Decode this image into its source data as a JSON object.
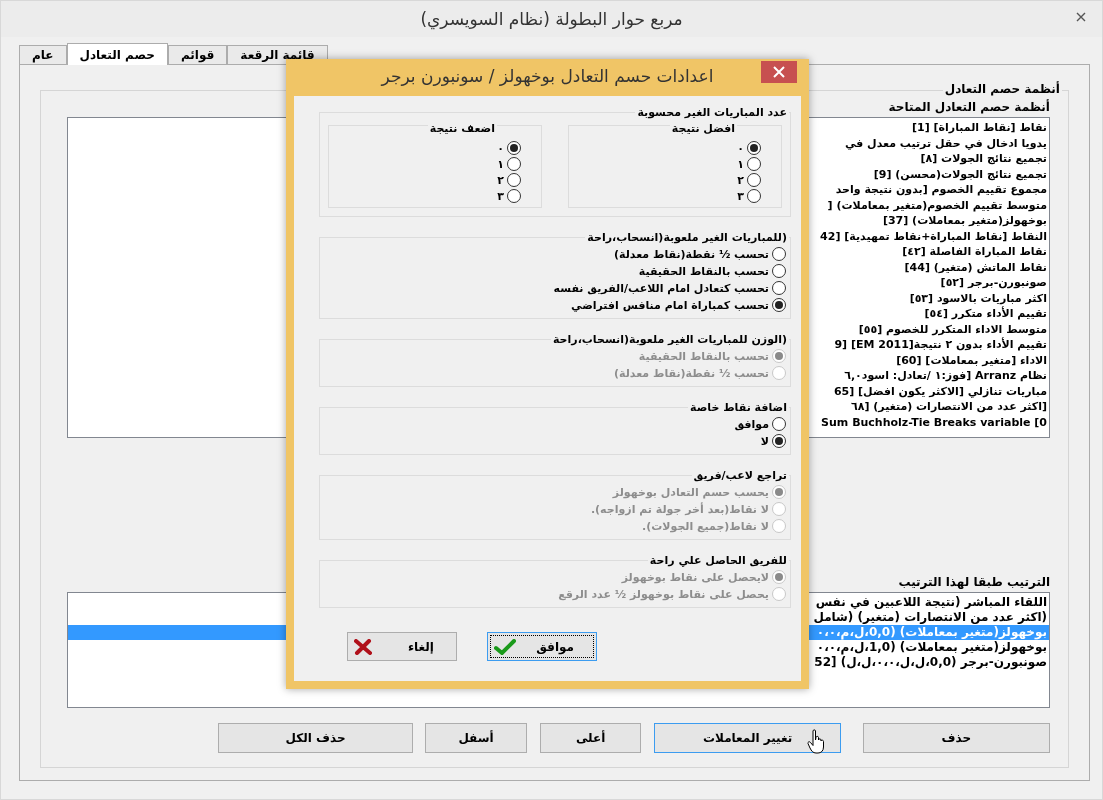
{
  "window": {
    "title": "مربع حوار البطولة (نظام السويسري)"
  },
  "tabs": [
    {
      "label": "قائمة الرقعة",
      "selected": false
    },
    {
      "label": "قوائم",
      "selected": false
    },
    {
      "label": "حصم التعادل",
      "selected": true
    },
    {
      "label": "عام",
      "selected": false
    }
  ],
  "tiebreak_group": {
    "title": "أنظمة حصم التعادل",
    "available_label": "أنظمة حصم التعادل المتاحة",
    "available": [
      "نقاط [نقاط المباراة] [1]",
      "يدويا ادخال في حقل ترتيب معدل في",
      "تجميع نتائج الجولات [٨]",
      "تجميع نتائج الجولات(محسن) [9]",
      "مجموع تقييم الخصوم [بدون نتيجة واحد",
      "متوسط تقييم الخصوم(متغير بمعاملات) [",
      "بوخهولز(متغير بمعاملات) [37]",
      "النقاط [نقاط المباراة+نقاط تمهيدية] [42",
      "نقاط المباراة الفاصلة [٤٢]",
      "نقاط الماتش (متغير) [44]",
      "صونبورن-برجر [٥٢]",
      "اكثر مباريات بالاسود [٥٣]",
      "تقييم الأداء متكرر [٥٤]",
      "متوسط الاداء المتكرر للخصوم [٥٥]",
      "تقييم الأداء بدون ٢ نتيجة[EM 2011] [9",
      "الاداء [متغير بمعاملات] [60]",
      "نظام Arranz [فوز:١ /تعادل: اسود٦,٠",
      "مباريات تنازلي [الاكثر يكون افضل] [65",
      "[اكثر عدد من الانتصارات (متغير) [٦٨",
      "Sum Buchholz-Tie Breaks variable [0"
    ],
    "order_label": "الترتيب طبقا لهذا الترتيب",
    "order": [
      {
        "text": "اللقاء المباشر (نتيجة اللاعبين في نفس",
        "selected": false
      },
      {
        "text": "(اكثر عدد من الانتصارات (متغير) (شامل",
        "selected": false
      },
      {
        "text": "بوخهولز(متغير بمعاملات) (0,0،ل،م،٠،٠",
        "selected": true
      },
      {
        "text": "بوخهولز(متغير بمعاملات) (1,0،ل،م،٠،٠",
        "selected": false
      },
      {
        "text": "صونبورن-برجر (0,0،ل،ل،٠،٠،ل،ل)  [52",
        "selected": false
      }
    ]
  },
  "buttons": [
    {
      "label": "حذف",
      "hovered": false
    },
    {
      "label": "تغيير المعاملات",
      "hovered": true
    },
    {
      "label": "أعلى",
      "hovered": false
    },
    {
      "label": "أسفل",
      "hovered": false
    },
    {
      "label": "حذف الكل",
      "hovered": false
    }
  ],
  "dialog": {
    "title": "اعدادات حسم التعادل بوخهولز / سونبورن برجر",
    "groups": [
      {
        "kind": "columns",
        "title": "عدد المباريات الغير محسوبة",
        "disabled": false,
        "columns": [
          {
            "title": "افضل نتيجة",
            "options": [
              {
                "label": "٠",
                "selected": true
              },
              {
                "label": "١",
                "selected": false
              },
              {
                "label": "٢",
                "selected": false
              },
              {
                "label": "٣",
                "selected": false
              }
            ]
          },
          {
            "title": "اضعف نتيجة",
            "options": [
              {
                "label": "٠",
                "selected": true
              },
              {
                "label": "١",
                "selected": false
              },
              {
                "label": "٢",
                "selected": false
              },
              {
                "label": "٣",
                "selected": false
              }
            ]
          }
        ]
      },
      {
        "kind": "list",
        "title": "(للمباريات الغير ملعوبة(انسحاب،راحة",
        "disabled": false,
        "options": [
          {
            "label": "تحسب ½ نقطة(نقاط معدلة)",
            "selected": false
          },
          {
            "label": "تحسب بالنقاط الحقيقية",
            "selected": false
          },
          {
            "label": "تحسب كتعادل امام اللاعب/الفريق نفسه",
            "selected": false
          },
          {
            "label": "تحسب كمباراة امام منافس افتراضي",
            "selected": true
          }
        ]
      },
      {
        "kind": "list",
        "title": "(الوزن للمباريات الغير ملعوبة(انسحاب،راحة",
        "disabled": true,
        "options": [
          {
            "label": "تحسب بالنقاط الحقيقية",
            "selected": true
          },
          {
            "label": "تحسب ½ نقطة(نقاط معدلة)",
            "selected": false
          }
        ]
      },
      {
        "kind": "list",
        "title": "اضافة نقاط خاصة",
        "disabled": false,
        "options": [
          {
            "label": "موافق",
            "selected": false
          },
          {
            "label": "لا",
            "selected": true
          }
        ]
      },
      {
        "kind": "list",
        "title": "تراجع لاعب/فريق",
        "disabled": true,
        "options": [
          {
            "label": "يحسب حسم التعادل بوخهولز",
            "selected": true
          },
          {
            "label": "لا نقاط(بعد أخر جولة تم ازواجه).",
            "selected": false
          },
          {
            "label": "لا نقاط(جميع الجولات).",
            "selected": false
          }
        ]
      },
      {
        "kind": "list",
        "title": "للفريق الحاصل علي راحة",
        "disabled": true,
        "options": [
          {
            "label": "لايحصل على نقاط بوخهولز",
            "selected": true
          },
          {
            "label": "يحصل على نقاط بوخهولز ½ عدد الرقع",
            "selected": false
          }
        ]
      }
    ],
    "buttons": [
      {
        "kind": "ok",
        "label": "موافق",
        "focused": true
      },
      {
        "kind": "cancel",
        "label": "إلغاء",
        "focused": false
      }
    ]
  }
}
